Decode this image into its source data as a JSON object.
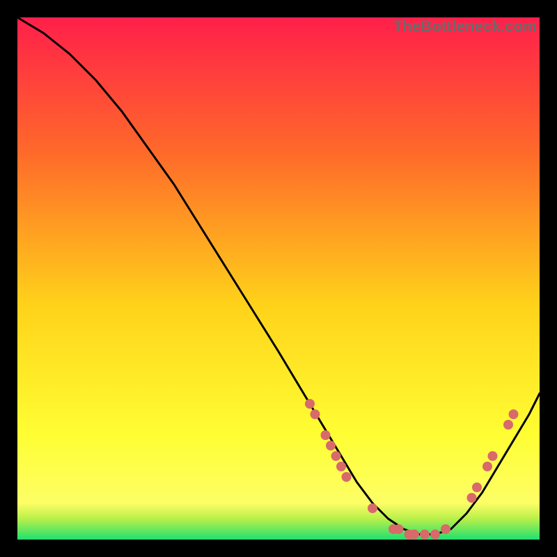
{
  "watermark": "TheBottleneck.com",
  "colors": {
    "grad_top": "#ff1f4a",
    "grad_mid1": "#ff6a2a",
    "grad_mid2": "#ffd21a",
    "grad_mid3": "#fffe33",
    "grad_bottom_yellow": "#fdfe66",
    "grad_green": "#20e070",
    "curve": "#000000",
    "marker": "#d86a6a",
    "background": "#000000"
  },
  "chart_data": {
    "type": "line",
    "title": "",
    "xlabel": "",
    "ylabel": "",
    "xlim": [
      0,
      100
    ],
    "ylim": [
      0,
      100
    ],
    "legend": false,
    "grid": false,
    "series": [
      {
        "name": "bottleneck-curve",
        "x": [
          0,
          5,
          10,
          15,
          20,
          25,
          30,
          35,
          40,
          45,
          50,
          53,
          56,
          59,
          62,
          65,
          68,
          71,
          74,
          77,
          80,
          83,
          86,
          89,
          92,
          95,
          98,
          100
        ],
        "y": [
          100,
          97,
          93,
          88,
          82,
          75,
          68,
          60,
          52,
          44,
          36,
          31,
          26,
          21,
          16,
          11,
          7,
          4,
          2,
          1,
          1,
          2,
          5,
          9,
          14,
          19,
          24,
          28
        ]
      }
    ],
    "markers": [
      {
        "x": 56,
        "y": 26
      },
      {
        "x": 57,
        "y": 24
      },
      {
        "x": 59,
        "y": 20
      },
      {
        "x": 60,
        "y": 18
      },
      {
        "x": 61,
        "y": 16
      },
      {
        "x": 62,
        "y": 14
      },
      {
        "x": 63,
        "y": 12
      },
      {
        "x": 68,
        "y": 6
      },
      {
        "x": 72,
        "y": 2
      },
      {
        "x": 73,
        "y": 2
      },
      {
        "x": 75,
        "y": 1
      },
      {
        "x": 76,
        "y": 1
      },
      {
        "x": 78,
        "y": 1
      },
      {
        "x": 80,
        "y": 1
      },
      {
        "x": 82,
        "y": 2
      },
      {
        "x": 87,
        "y": 8
      },
      {
        "x": 88,
        "y": 10
      },
      {
        "x": 90,
        "y": 14
      },
      {
        "x": 91,
        "y": 16
      },
      {
        "x": 94,
        "y": 22
      },
      {
        "x": 95,
        "y": 24
      }
    ]
  }
}
